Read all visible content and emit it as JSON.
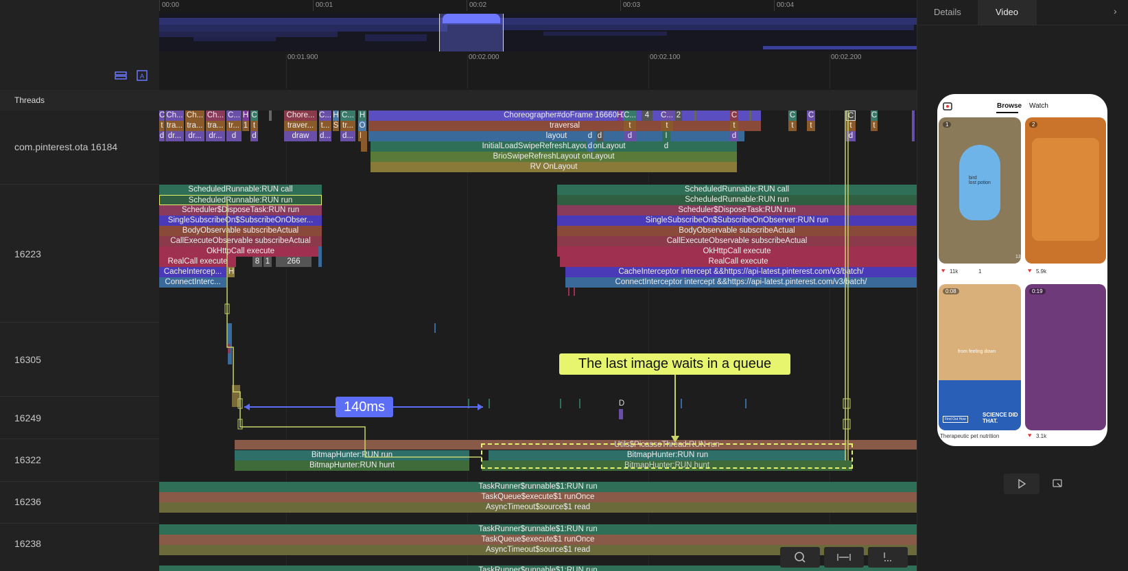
{
  "ruler": {
    "ticks": [
      "00:00",
      "00:01",
      "00:02",
      "00:03",
      "00:04"
    ]
  },
  "subruler": {
    "ticks": [
      "00:01.900",
      "00:02.000",
      "00:02.100",
      "00:02.200"
    ]
  },
  "left": {
    "header": "Threads"
  },
  "threads": [
    {
      "label": "com.pinterest.ota 16184"
    },
    {
      "label": "16223"
    },
    {
      "label": "16305"
    },
    {
      "label": "16249"
    },
    {
      "label": "16322"
    },
    {
      "label": "16236"
    },
    {
      "label": "16238"
    }
  ],
  "main_thread": {
    "small_labels": [
      "C",
      "Ch...",
      "Ch...",
      "Ch...",
      "C...",
      "H",
      "C",
      "Chore...",
      "C...",
      "H",
      "C...",
      "H"
    ],
    "small_labels_row2": [
      "t",
      "tra...",
      "tra...",
      "tra...",
      "tr...",
      "1",
      "t",
      "traver...",
      "t...",
      "S",
      "tr...",
      "O"
    ],
    "small_labels_row3": [
      "d",
      "dr...",
      "dr...",
      "dr...",
      "d",
      "d",
      "draw",
      "d...",
      "d...",
      "E"
    ],
    "choreographer": "Choreographer#doFrame 1666000",
    "traversal": "traversal",
    "layout": "layout",
    "initial_load": "InitialLoadSwipeRefreshLayout onLayout",
    "brio": "BrioSwipeRefreshLayout onLayout",
    "rv": "RV OnLayout",
    "right_labels": [
      "H",
      "C...",
      "4",
      "C...",
      "2",
      "C",
      "C",
      "C",
      "C",
      "C"
    ],
    "right_row2": [
      "t",
      "t",
      "t",
      "t",
      "t",
      "t",
      "t"
    ],
    "right_row3": [
      "d",
      "d",
      "d",
      "d",
      "d",
      "I",
      "d",
      "d"
    ]
  },
  "thread_16223": {
    "left_stack": [
      "ScheduledRunnable:RUN call",
      "ScheduledRunnable:RUN run",
      "Scheduler$DisposeTask:RUN run",
      "SingleSubscribeOn$SubscribeOnObser...",
      "BodyObservable subscribeActual",
      "CallExecuteObservable subscribeActual",
      "OkHttpCall execute",
      "RealCall execute",
      "CacheIntercep...",
      "ConnectInterc..."
    ],
    "left_small": [
      "8",
      "1",
      "266",
      "H"
    ],
    "right_stack": [
      "ScheduledRunnable:RUN call",
      "ScheduledRunnable:RUN run",
      "Scheduler$DisposeTask:RUN run",
      "SingleSubscribeOn$SubscribeOnObserver:RUN run",
      "BodyObservable subscribeActual",
      "CallExecuteObservable subscribeActual",
      "OkHttpCall execute",
      "RealCall execute",
      "CacheInterceptor intercept &&https://api-latest.pinterest.com/v3/batch/",
      "ConnectInterceptor intercept &&https://api-latest.pinterest.com/v3/batch/"
    ]
  },
  "thread_16249": {
    "label": "D"
  },
  "thread_16322": {
    "left": [
      "BitmapHunter:RUN run",
      "BitmapHunter:RUN hunt"
    ],
    "right": [
      "Utils$PicassoThread:RUN run",
      "BitmapHunter:RUN run",
      "BitmapHunter:RUN hunt"
    ]
  },
  "thread_16236": [
    "TaskRunner$runnable$1:RUN run",
    "TaskQueue$execute$1 runOnce",
    "AsyncTimeout$source$1 read"
  ],
  "thread_16238": [
    "TaskRunner$runnable$1:RUN run",
    "TaskQueue$execute$1 runOnce",
    "AsyncTimeout$source$1 read",
    "TaskRunner$runnable$1:RUN run"
  ],
  "annotations": {
    "note": "The last image waits in a queue",
    "duration": "140ms"
  },
  "right_panel": {
    "tabs": [
      "Details",
      "Video"
    ],
    "active_tab": "Video",
    "phone": {
      "tabs": [
        "Browse",
        "Watch"
      ],
      "cards": [
        {
          "badge": "1",
          "likes": "11k",
          "shares": "1"
        },
        {
          "badge": "2",
          "likes": "5.9k"
        },
        {
          "badge": "0:08",
          "caption": "Therapeutic pet nutrition",
          "overlay": "from feeling down",
          "ad_text": "SCIENCE DID THAT.",
          "button": "Find Out How"
        },
        {
          "badge": "0:19",
          "likes": "3.1k"
        }
      ],
      "vase_text": "bird\nlost potion",
      "card2_text": "",
      "count_text": "13"
    }
  },
  "colors": {
    "accent_yellow": "#e6f56d",
    "accent_blue": "#5b6ef5",
    "line_yellow": "#c8d46a"
  }
}
